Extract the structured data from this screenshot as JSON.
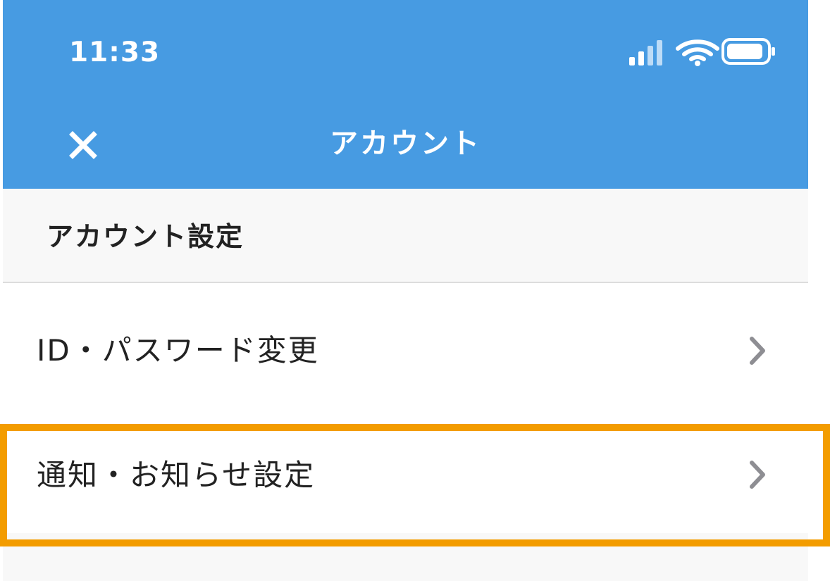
{
  "status_bar": {
    "time": "11:33",
    "signal_icon": "cellular-signal-icon",
    "wifi_icon": "wifi-icon",
    "battery_icon": "battery-icon"
  },
  "navigation": {
    "close_icon": "close-icon",
    "title": "アカウント"
  },
  "section": {
    "title": "アカウント設定"
  },
  "menu": {
    "items": [
      {
        "label": "ID・パスワード変更",
        "icon": "chevron-right-icon"
      },
      {
        "label": "通知・お知らせ設定",
        "icon": "chevron-right-icon"
      }
    ]
  },
  "colors": {
    "header_background": "#479BE2",
    "highlight_border": "#F39C00",
    "page_background": "#F8F8F8",
    "text": "#222222",
    "chevron": "#8E8E93",
    "divider": "#DDDDDD"
  }
}
